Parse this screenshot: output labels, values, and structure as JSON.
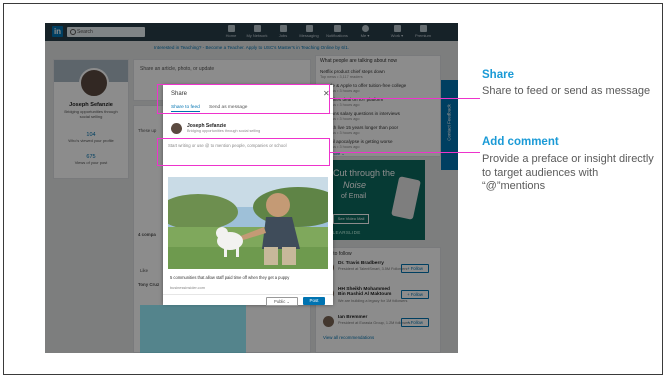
{
  "screenshot": {
    "search_placeholder": "Search",
    "nav_items": [
      "Home",
      "My Network",
      "Jobs",
      "Messaging",
      "Notifications",
      "Me ▾",
      "Work ▾",
      "Premium"
    ],
    "banner": "Interested in Teaching? - Become a Teacher. Apply to USC's Master's in Teaching Online by 6/1.",
    "profile": {
      "name": "Joseph Sefanzie",
      "headline": "Bridging opportunities through social selling",
      "views_count": "104",
      "views_label": "Who's viewed your profile",
      "post_count": "675",
      "post_label": "Views of your post"
    },
    "feed": {
      "share_prompt": "Share an article, photo, or update",
      "these_label": "These up",
      "comp_label": "4 compa",
      "like_label": "Like",
      "time_label": "Tony Cruz"
    },
    "news": {
      "header": "What people are talking about now",
      "items": [
        {
          "title": "Netflix product chief steps down",
          "sub": "Top news • 3,117 readers"
        },
        {
          "title": "Google & Apple to offer tuition-free college",
          "sub": "Top news • 3 hours ago"
        },
        {
          "title": "GE strikes deal on IoT platform",
          "sub": "Top news • 3 hours ago"
        },
        {
          "title": "WC bans salary questions in interviews",
          "sub": "Top news • 3 hours ago"
        },
        {
          "title": "US, rich live 15 years longer than poor",
          "sub": "Top news • 3 hours ago"
        },
        {
          "title": "Is retail apocalypse is getting worse",
          "sub": "Top news • 3 hours ago"
        }
      ],
      "show_more": "Show more ⌄"
    },
    "ad": {
      "line1": "Cut through the",
      "line2": "Noise",
      "line3": "of Email",
      "button": "See Video Mail",
      "brand": "CLEARSLIDE"
    },
    "side_tab": "Contact Feedback",
    "follow": {
      "header": "Add to follow",
      "people": [
        {
          "name": "Dr. Travis Bradberry",
          "sub": "President at TalentSmart, 3.5M Followers",
          "button": "+ Follow"
        },
        {
          "name": "HH Sheikh Mohammed Bin Rashid Al Maktoum",
          "sub": "We are building a legacy for 1M followers",
          "button": "+ Follow"
        },
        {
          "name": "Ian Bremmer",
          "sub": "President at Eurasia Group, 1.2M followers",
          "button": "+ Follow"
        }
      ],
      "view_all": "View all recommendations"
    },
    "modal": {
      "title": "Share",
      "close": "✕",
      "tab_feed": "Share to feed",
      "tab_message": "Send as message",
      "author_name": "Joseph Sefanzie",
      "author_headline": "Bridging opportunities through social selling",
      "input_placeholder": "Start writing or use @ to mention people, companies or school",
      "caption": "5 communities that allow staff paid time off when they get a puppy",
      "caption_source": "businessinsider.com",
      "visibility": "Public ⌄",
      "post_button": "Post"
    }
  },
  "annotations": [
    {
      "title": "Share",
      "body": "Share to feed or send as message"
    },
    {
      "title": "Add comment",
      "body": "Provide a preface or insight directly to target audiences with “@”mentions"
    }
  ],
  "colors": {
    "highlight": "#ee33cc",
    "annotation_title": "#1a9ad6",
    "linkedin_blue": "#0073b1",
    "topbar": "#283e4a"
  }
}
